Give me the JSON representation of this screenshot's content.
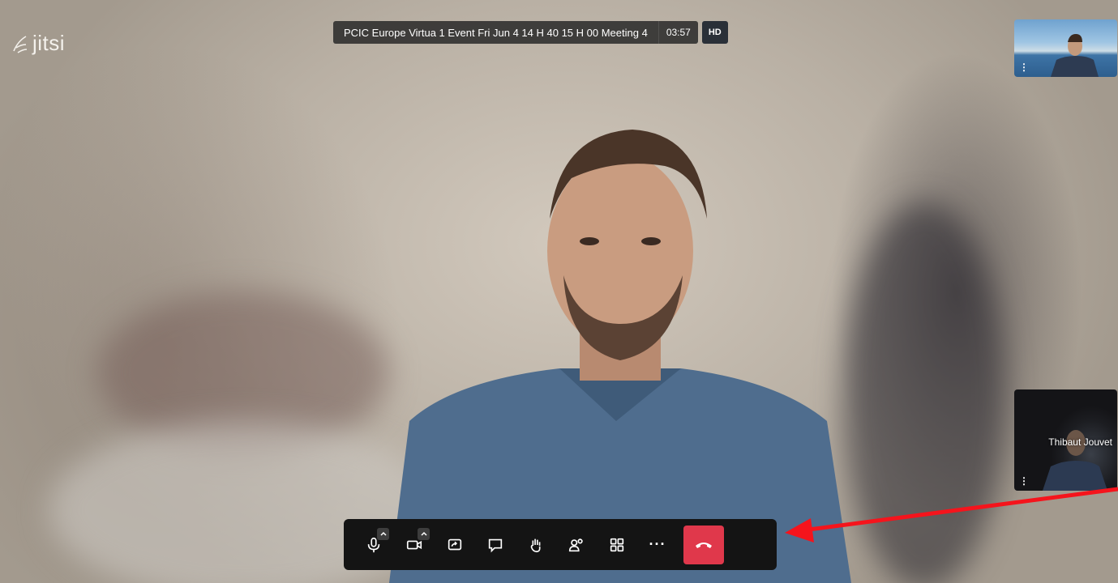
{
  "app": {
    "logo_text": "jitsi"
  },
  "meeting": {
    "title": "PCIC Europe Virtua 1 Event Fri Jun 4 14 H 40 15 H 00 Meeting 4",
    "timer": "03:57",
    "quality_badge": "HD"
  },
  "participants": [
    {
      "name": "",
      "position": "top"
    },
    {
      "name": "Thibaut Jouvet",
      "position": "bottom"
    }
  ],
  "toolbar": {
    "buttons": [
      "microphone-icon",
      "camera-icon",
      "share-screen-icon",
      "chat-icon",
      "raise-hand-icon",
      "participants-icon",
      "tile-view-icon",
      "more-options-icon",
      "hangup-icon"
    ],
    "more_label": "···"
  },
  "colors": {
    "hangup": "#e0384b",
    "toolbar_bg": "#141414",
    "annotation_arrow": "#f5141c"
  }
}
